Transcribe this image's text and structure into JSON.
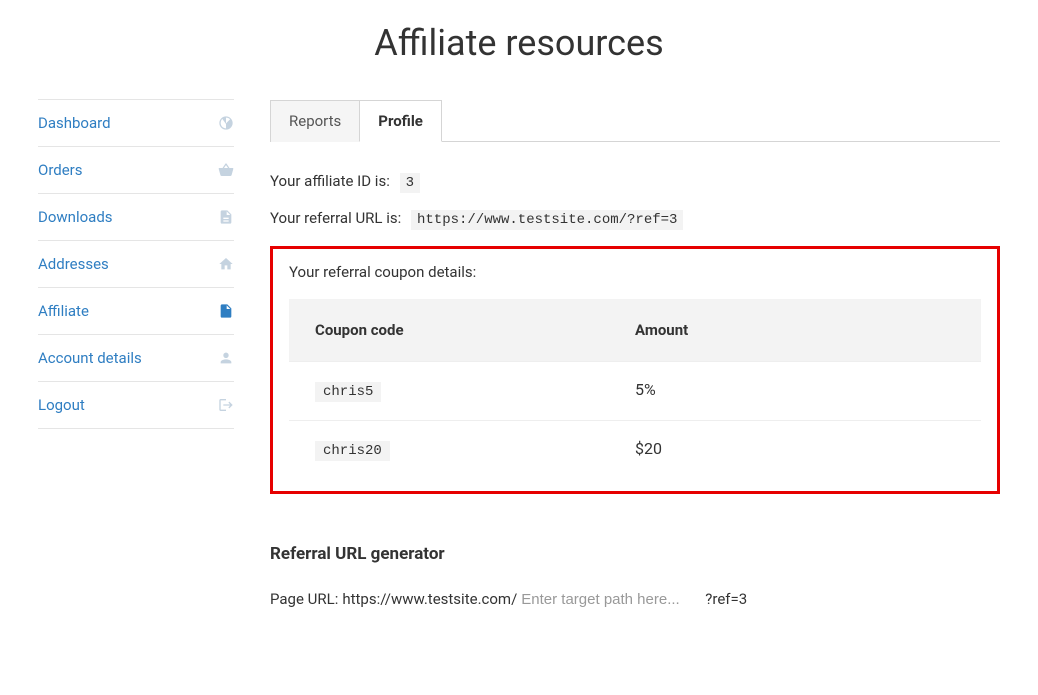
{
  "page_title": "Affiliate resources",
  "sidebar": {
    "items": [
      {
        "label": "Dashboard",
        "icon": "dashboard-icon"
      },
      {
        "label": "Orders",
        "icon": "basket-icon"
      },
      {
        "label": "Downloads",
        "icon": "file-icon"
      },
      {
        "label": "Addresses",
        "icon": "home-icon"
      },
      {
        "label": "Affiliate",
        "icon": "document-icon"
      },
      {
        "label": "Account details",
        "icon": "user-icon"
      },
      {
        "label": "Logout",
        "icon": "logout-icon"
      }
    ]
  },
  "tabs": {
    "items": [
      {
        "label": "Reports"
      },
      {
        "label": "Profile"
      }
    ]
  },
  "affiliate_id_label": "Your affiliate ID is:",
  "affiliate_id": "3",
  "referral_url_label": "Your referral URL is:",
  "referral_url": "https://www.testsite.com/?ref=3",
  "coupon_section_label": "Your referral coupon details:",
  "coupon_table": {
    "header_code": "Coupon code",
    "header_amount": "Amount",
    "rows": [
      {
        "code": "chris5",
        "amount": "5%"
      },
      {
        "code": "chris20",
        "amount": "$20"
      }
    ]
  },
  "url_generator": {
    "heading": "Referral URL generator",
    "page_url_label": "Page URL:",
    "base_url": "https://www.testsite.com/",
    "placeholder": "Enter target path here...",
    "suffix": "?ref=3"
  }
}
